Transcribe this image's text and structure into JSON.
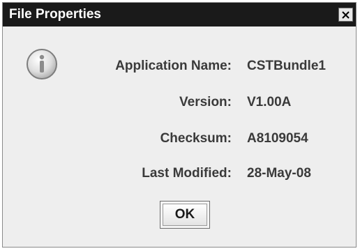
{
  "dialog": {
    "title": "File Properties",
    "close_icon": "close-icon",
    "info_icon": "info-icon",
    "fields": [
      {
        "label": "Application Name:",
        "value": "CSTBundle1"
      },
      {
        "label": "Version:",
        "value": "V1.00A"
      },
      {
        "label": "Checksum:",
        "value": "A8109054"
      },
      {
        "label": "Last Modified:",
        "value": "28-May-08"
      }
    ],
    "ok_label": "OK"
  },
  "colors": {
    "titlebar_bg": "#1a1a1a",
    "title_text": "#ffffff",
    "dialog_bg": "#eeeeee",
    "text": "#3a3a3a"
  }
}
